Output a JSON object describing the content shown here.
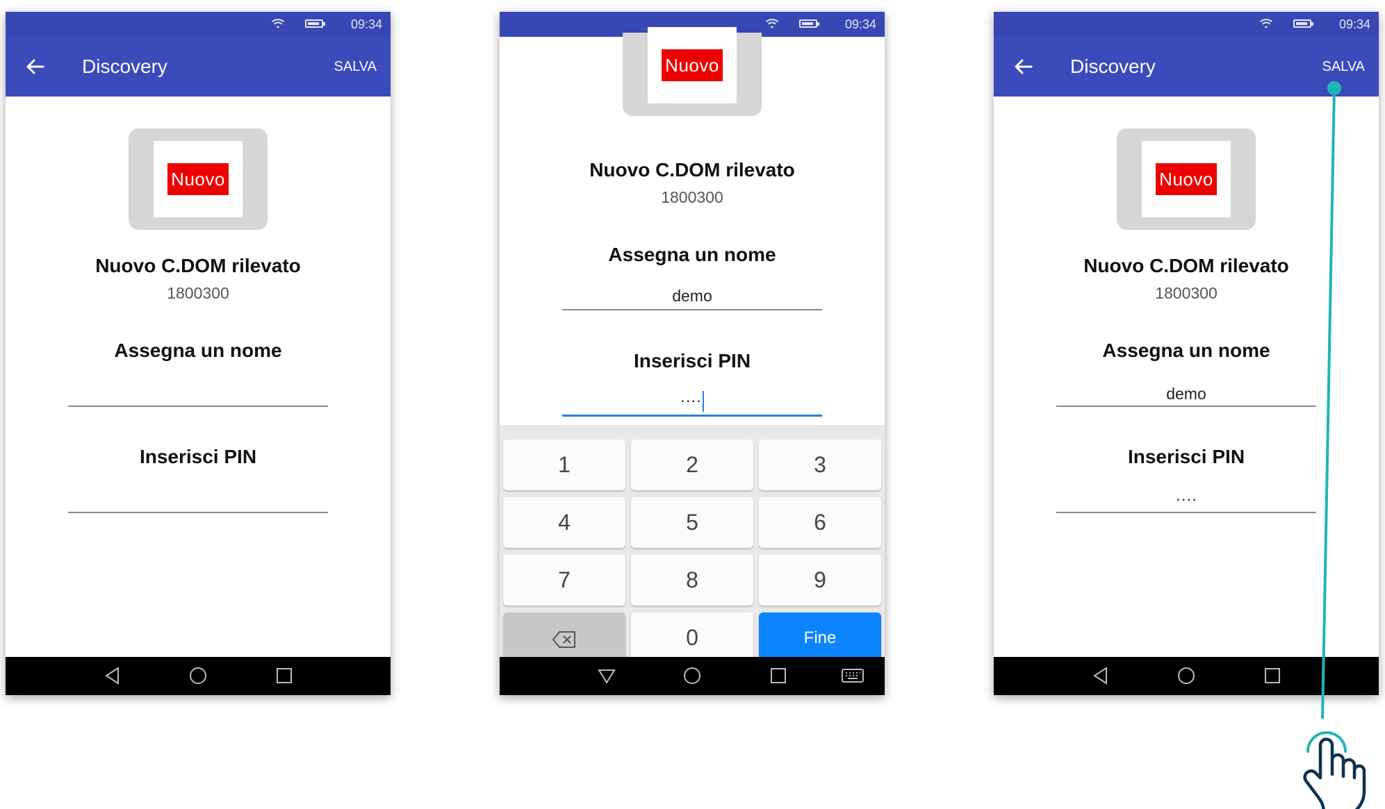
{
  "status": {
    "time": "09:34"
  },
  "screens": [
    {
      "app_bar": {
        "title": "Discovery",
        "save_label": "SALVA"
      },
      "device": {
        "badge": "Nuovo",
        "detected_text": "Nuovo C.DOM rilevato",
        "serial": "1800300"
      },
      "name_field": {
        "label": "Assegna un nome",
        "value": ""
      },
      "pin_field": {
        "label": "Inserisci PIN",
        "value": ""
      }
    },
    {
      "device": {
        "badge": "Nuovo",
        "detected_text": "Nuovo C.DOM rilevato",
        "serial": "1800300"
      },
      "name_field": {
        "label": "Assegna un nome",
        "value": "demo"
      },
      "pin_field": {
        "label": "Inserisci PIN",
        "value": "····"
      },
      "keyboard": {
        "keys": [
          "1",
          "2",
          "3",
          "4",
          "5",
          "6",
          "7",
          "8",
          "9",
          "0"
        ],
        "done_label": "Fine"
      }
    },
    {
      "app_bar": {
        "title": "Discovery",
        "save_label": "SALVA"
      },
      "device": {
        "badge": "Nuovo",
        "detected_text": "Nuovo C.DOM rilevato",
        "serial": "1800300"
      },
      "name_field": {
        "label": "Assegna un nome",
        "value": "demo"
      },
      "pin_field": {
        "label": "Inserisci PIN",
        "value": "····"
      }
    }
  ],
  "colors": {
    "app_bar": "#3b4bbb",
    "status_bar": "#3847b3",
    "badge_red": "#ee0000",
    "keyboard_done": "#0d84ff",
    "pointer_teal": "#1fb5b5",
    "hand_outline": "#0f3350"
  },
  "icons": [
    "wifi-icon",
    "battery-icon",
    "back-arrow-icon",
    "backspace-icon",
    "nav-back-icon",
    "nav-home-icon",
    "nav-recents-icon",
    "keyboard-icon",
    "tap-hand-icon"
  ]
}
